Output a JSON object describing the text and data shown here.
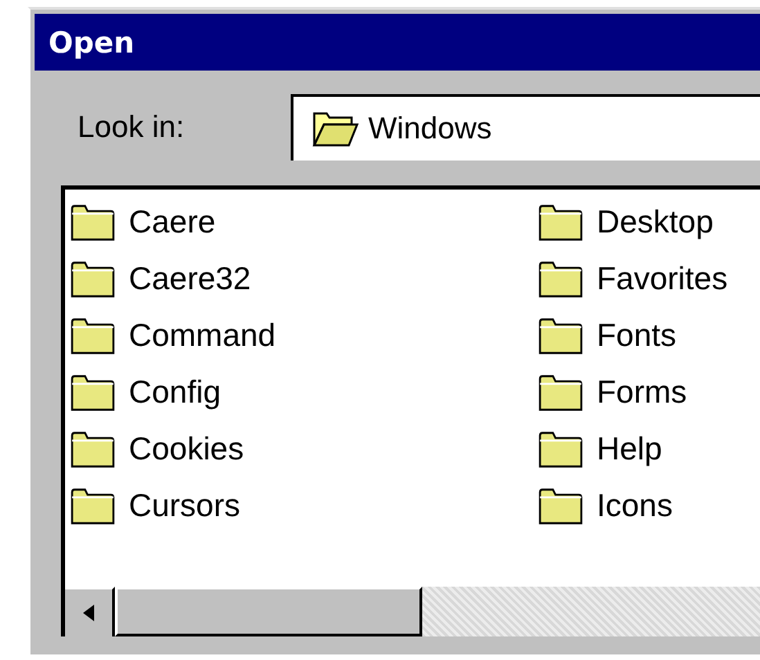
{
  "window": {
    "title": "Open"
  },
  "look_in": {
    "label": "Look in:",
    "value": "Windows"
  },
  "files": [
    {
      "name": "Caere"
    },
    {
      "name": "Caere32"
    },
    {
      "name": "Command"
    },
    {
      "name": "Config"
    },
    {
      "name": "Cookies"
    },
    {
      "name": "Cursors"
    },
    {
      "name": "Desktop"
    },
    {
      "name": "Favorites"
    },
    {
      "name": "Fonts"
    },
    {
      "name": "Forms"
    },
    {
      "name": "Help"
    },
    {
      "name": "Icons"
    }
  ]
}
